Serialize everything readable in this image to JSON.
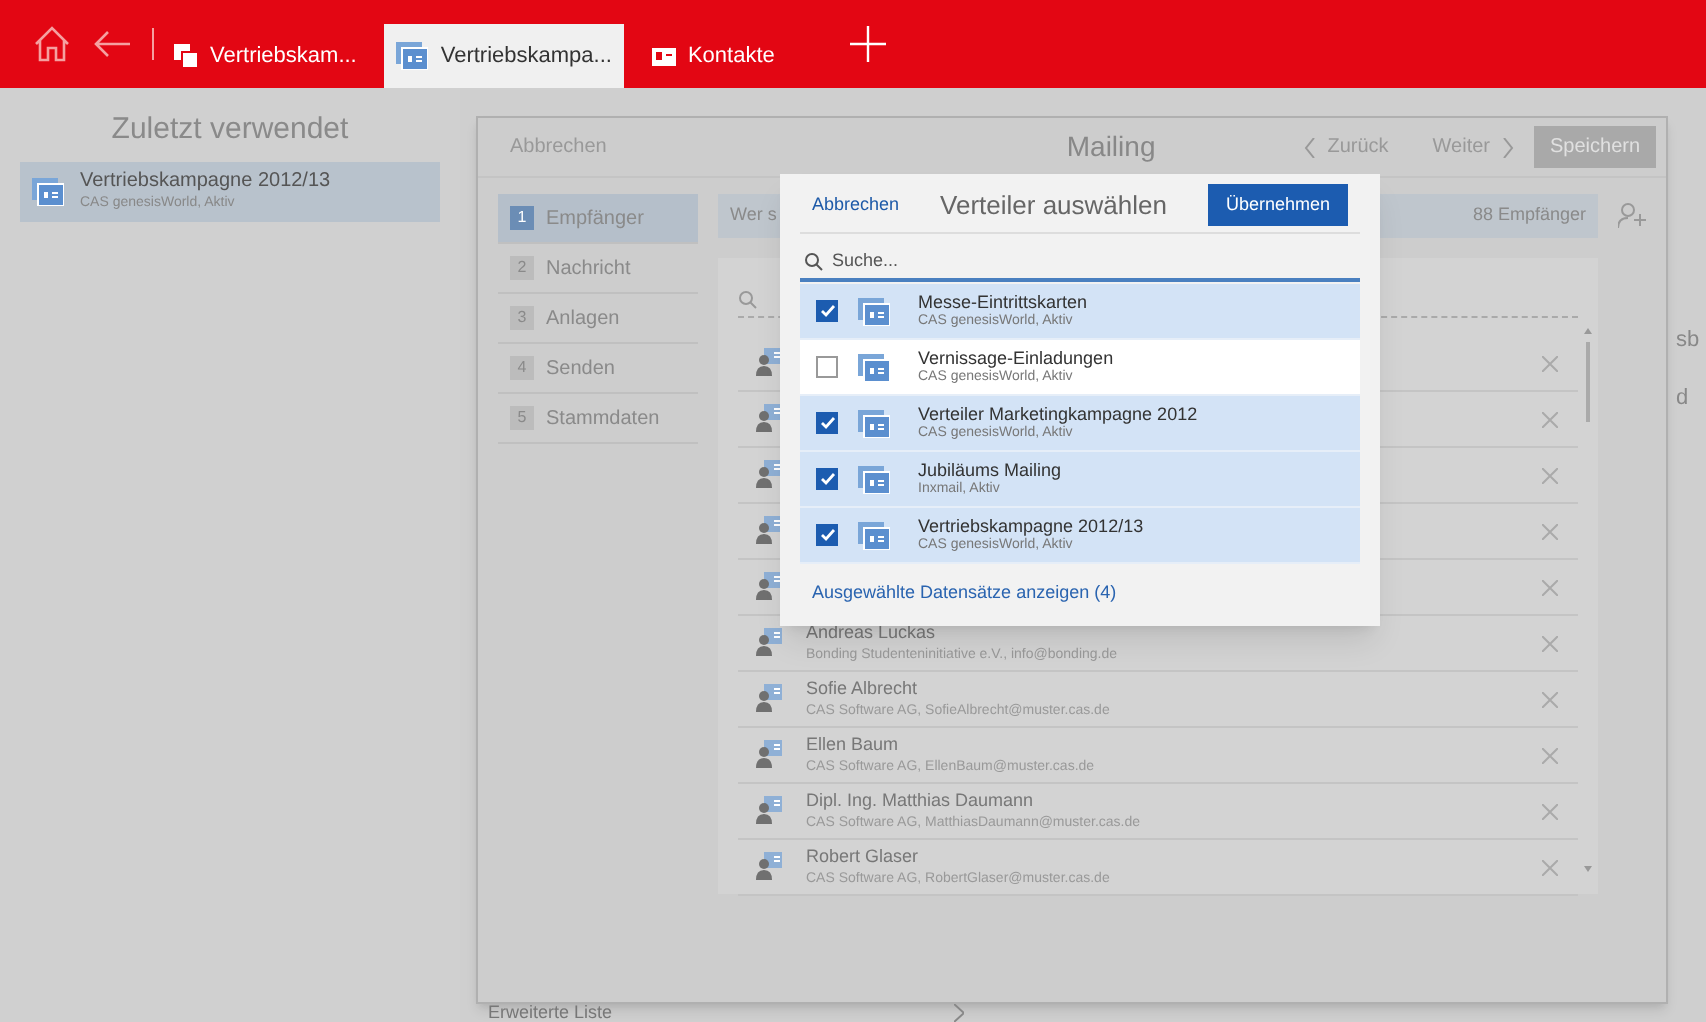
{
  "top_bar": {
    "tabs": [
      {
        "label": "Vertriebskam...",
        "selected": false,
        "kind": "campaign"
      },
      {
        "label": "Vertriebskampa...",
        "selected": true,
        "kind": "campaign"
      },
      {
        "label": "Kontakte",
        "selected": false,
        "kind": "contacts"
      }
    ]
  },
  "recent": {
    "title": "Zuletzt verwendet",
    "items": [
      {
        "name": "Vertriebskampagne 2012/13",
        "detail": "CAS genesisWorld, Aktiv",
        "selected": true
      }
    ]
  },
  "mailing": {
    "cancel": "Abbrechen",
    "title": "Mailing",
    "back": "Zurück",
    "next": "Weiter",
    "save": "Speichern",
    "steps": [
      {
        "number": "1",
        "label": "Empfänger",
        "selected": true
      },
      {
        "number": "2",
        "label": "Nachricht",
        "selected": false
      },
      {
        "number": "3",
        "label": "Anlagen",
        "selected": false
      },
      {
        "number": "4",
        "label": "Senden",
        "selected": false
      },
      {
        "number": "5",
        "label": "Stammdaten",
        "selected": false
      }
    ],
    "recipients_prompt": "Wer s",
    "recipient_count": "88 Empfänger",
    "contacts": [
      {
        "kind": "covered"
      },
      {
        "kind": "covered"
      },
      {
        "kind": "covered"
      },
      {
        "kind": "covered"
      },
      {
        "kind": "covered"
      },
      {
        "kind": "contact",
        "name": "Andreas Luckas",
        "detail": "Bonding Studenteninitiative e.V., info@bonding.de"
      },
      {
        "kind": "contact",
        "name": "Sofie Albrecht",
        "detail": "CAS Software AG, SofieAlbrecht@muster.cas.de"
      },
      {
        "kind": "contact",
        "name": "Ellen Baum",
        "detail": "CAS Software AG, EllenBaum@muster.cas.de"
      },
      {
        "kind": "contact",
        "name": "Dipl. Ing. Matthias Daumann",
        "detail": "CAS Software AG, MatthiasDaumann@muster.cas.de"
      },
      {
        "kind": "contact",
        "name": "Robert Glaser",
        "detail": "CAS Software AG, RobertGlaser@muster.cas.de"
      }
    ],
    "side_fragments": [
      "sb",
      "d"
    ],
    "extended_list": "Erweiterte Liste"
  },
  "dialog": {
    "cancel": "Abbrechen",
    "title": "Verteiler auswählen",
    "apply": "Übernehmen",
    "search": {
      "placeholder": "Suche..."
    },
    "items": [
      {
        "name": "Messe-Eintrittskarten",
        "detail": "CAS genesisWorld, Aktiv",
        "checked": true
      },
      {
        "name": "Vernissage-Einladungen",
        "detail": "CAS genesisWorld, Aktiv",
        "checked": false
      },
      {
        "name": "Verteiler Marketingkampagne 2012",
        "detail": "CAS genesisWorld, Aktiv",
        "checked": true
      },
      {
        "name": "Jubiläums Mailing",
        "detail": "Inxmail, Aktiv",
        "checked": true
      },
      {
        "name": "Vertriebskampagne 2012/13",
        "detail": "CAS genesisWorld, Aktiv",
        "checked": true
      }
    ],
    "show_selected": "Ausgewählte Datensätze anzeigen (4)"
  }
}
